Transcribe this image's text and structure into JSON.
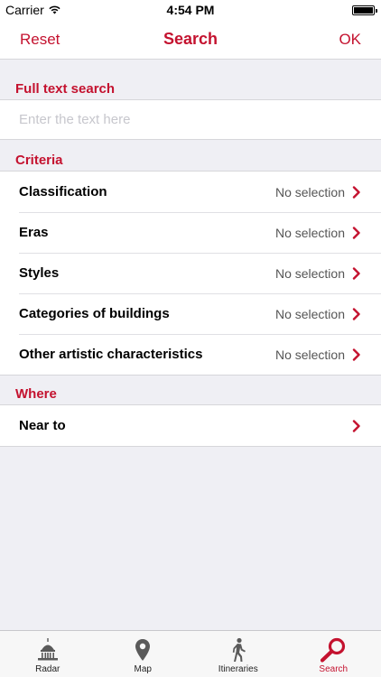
{
  "status_bar": {
    "carrier": "Carrier",
    "time": "4:54 PM"
  },
  "nav": {
    "left_label": "Reset",
    "title": "Search",
    "right_label": "OK"
  },
  "full_text": {
    "header": "Full text search",
    "placeholder": "Enter the text here",
    "value": ""
  },
  "criteria": {
    "header": "Criteria",
    "items": [
      {
        "label": "Classification",
        "value": "No selection"
      },
      {
        "label": "Eras",
        "value": "No selection"
      },
      {
        "label": "Styles",
        "value": "No selection"
      },
      {
        "label": "Categories of buildings",
        "value": "No selection"
      },
      {
        "label": "Other artistic characteristics",
        "value": "No selection"
      }
    ]
  },
  "where": {
    "header": "Where",
    "items": [
      {
        "label": "Near to",
        "value": ""
      }
    ]
  },
  "tabs": [
    {
      "label": "Radar",
      "icon": "capitol-dome-icon",
      "active": false
    },
    {
      "label": "Map",
      "icon": "map-pin-icon",
      "active": false
    },
    {
      "label": "Itineraries",
      "icon": "walking-person-icon",
      "active": false
    },
    {
      "label": "Search",
      "icon": "magnifier-icon",
      "active": true
    }
  ],
  "colors": {
    "accent": "#c4122f",
    "background": "#efeff4"
  }
}
